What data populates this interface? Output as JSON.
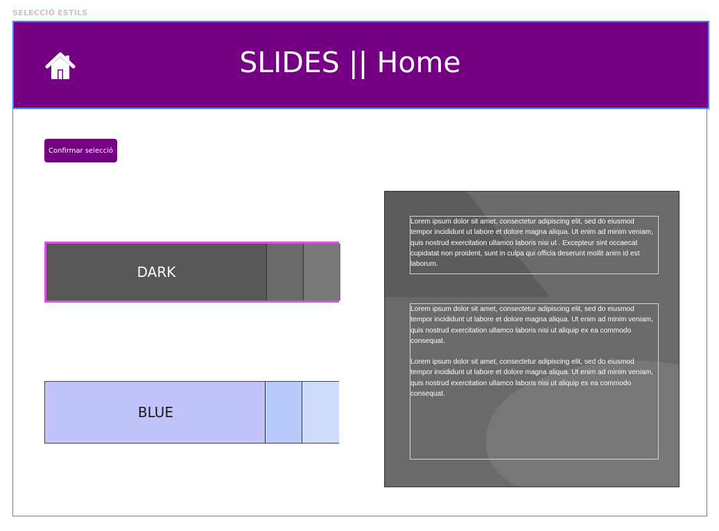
{
  "frame": {
    "label": "SELECCIÓ ESTILS"
  },
  "header": {
    "title": "SLIDES || Home",
    "home_icon": "home-icon",
    "background_color": "#760084",
    "border_color": "#2d8cf0"
  },
  "actions": {
    "confirm_label": "Confirmar selecció"
  },
  "styles": [
    {
      "name": "DARK",
      "selected": true,
      "colors": [
        "#575757",
        "#6a6a6a",
        "#777777"
      ],
      "highlight_color": "#e050e8"
    },
    {
      "name": "BLUE",
      "selected": false,
      "colors": [
        "#c0c4fb",
        "#b9cafd",
        "#cedbfd"
      ]
    }
  ],
  "preview": {
    "background_color": "#6a6a6a",
    "box1": {
      "text": "Lorem ipsum dolor sit amet, consectetur adipiscing elit, sed do eiusmod tempor incididunt ut labore et dolore magna aliqua. Ut enim ad minim veniam, quis nostrud exercitation ullamco laboris nisi ut . Excepteur sint occaecat cupidatat non proident, sunt in culpa qui officia deserunt mollit anim id est laborum."
    },
    "box2": {
      "paragraph1": "Lorem ipsum dolor sit amet, consectetur adipiscing elit, sed do eiusmod tempor incididunt ut labore et dolore magna aliqua. Ut enim ad minim veniam, quis nostrud exercitation ullamco laboris nisi ut aliquip ex ea commodo consequat.",
      "paragraph2": "Lorem ipsum dolor sit amet, consectetur adipiscing elit, sed do eiusmod tempor incididunt ut labore et dolore magna aliqua. Ut enim ad minim veniam, quis nostrud exercitation ullamco laboris nisi ut aliquip ex ea commodo consequat."
    }
  }
}
